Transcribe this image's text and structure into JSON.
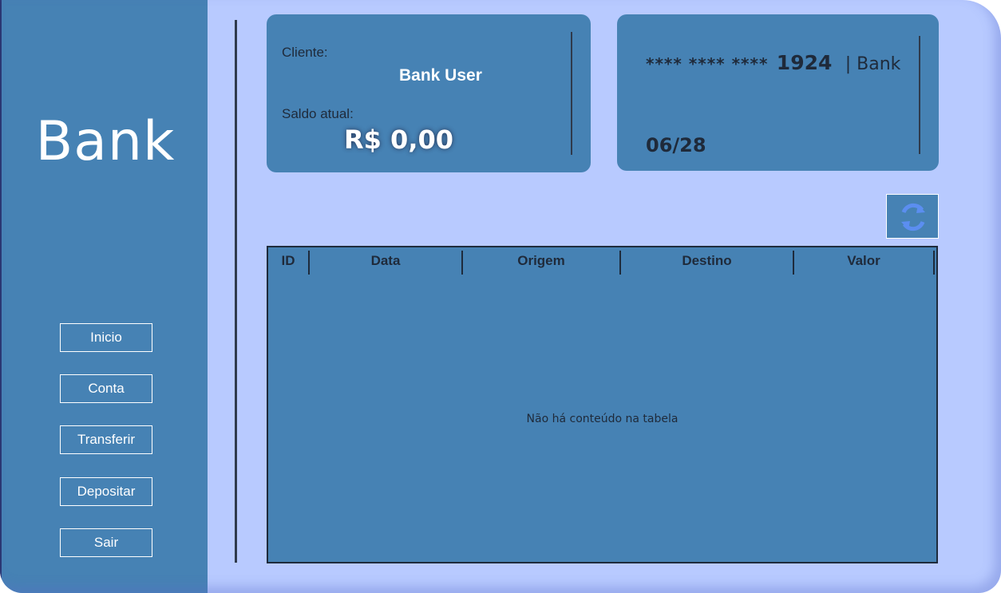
{
  "app": {
    "logo": "Bank"
  },
  "sidebar": {
    "items": [
      {
        "label": "Inicio"
      },
      {
        "label": "Conta"
      },
      {
        "label": "Transferir"
      },
      {
        "label": "Depositar"
      },
      {
        "label": "Sair"
      }
    ]
  },
  "account": {
    "client_label": "Cliente:",
    "client_name": "Bank User",
    "balance_label": "Saldo atual:",
    "balance": "R$ 0,00"
  },
  "card": {
    "masked": "**** **** ****",
    "last4": "1924",
    "bank": "| Bank",
    "expiry": "06/28"
  },
  "refresh": {
    "icon": "refresh-icon"
  },
  "table": {
    "columns": [
      "ID",
      "Data",
      "Origem",
      "Destino",
      "Valor"
    ],
    "rows": [],
    "empty_message": "Não há conteúdo na tabela"
  },
  "colors": {
    "background": "#b8caff",
    "panel": "#4682b4",
    "text_dark": "#1f2a3a",
    "text_light": "#ffffff",
    "refresh_icon": "#5b8ef0"
  }
}
